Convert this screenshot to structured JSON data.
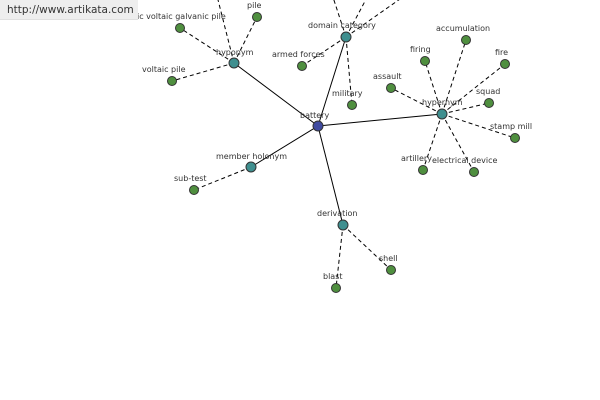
{
  "watermark": "http://www.artikata.com",
  "colors": {
    "center": "#3f4aa0",
    "relation": "#3f8f8f",
    "leaf": "#4f8f3f",
    "edge": "#000000"
  },
  "nodes": [
    {
      "id": "battery",
      "label": "battery",
      "kind": "center"
    },
    {
      "id": "hyponym",
      "label": "hyponym",
      "kind": "relation"
    },
    {
      "id": "domain-category",
      "label": "domain category",
      "kind": "relation"
    },
    {
      "id": "hypernym",
      "label": "hypernym",
      "kind": "relation"
    },
    {
      "id": "member-holonym",
      "label": "member holonym",
      "kind": "relation"
    },
    {
      "id": "derivation",
      "label": "derivation",
      "kind": "relation"
    },
    {
      "id": "voltaic-galvanic-pile",
      "label": "ic voltaic galvanic pile",
      "kind": "leaf"
    },
    {
      "id": "pile",
      "label": "pile",
      "kind": "leaf"
    },
    {
      "id": "voltaic-pile",
      "label": "voltaic pile",
      "kind": "leaf"
    },
    {
      "id": "armed-forces",
      "label": "armed forces",
      "kind": "leaf"
    },
    {
      "id": "military",
      "label": "military",
      "kind": "leaf"
    },
    {
      "id": "accumulation",
      "label": "accumulation",
      "kind": "leaf"
    },
    {
      "id": "firing",
      "label": "firing",
      "kind": "leaf"
    },
    {
      "id": "fire",
      "label": "fire",
      "kind": "leaf"
    },
    {
      "id": "assault",
      "label": "assault",
      "kind": "leaf"
    },
    {
      "id": "squad",
      "label": "squad",
      "kind": "leaf"
    },
    {
      "id": "stamp-mill",
      "label": "stamp mill",
      "kind": "leaf"
    },
    {
      "id": "artillery",
      "label": "artillery",
      "kind": "leaf"
    },
    {
      "id": "electrical-device",
      "label": "electrical device",
      "kind": "leaf"
    },
    {
      "id": "sub-test",
      "label": "sub-test",
      "kind": "leaf"
    },
    {
      "id": "shell",
      "label": "shell",
      "kind": "leaf"
    },
    {
      "id": "blast",
      "label": "blast",
      "kind": "leaf"
    },
    {
      "id": "offscreen-1",
      "label": "",
      "kind": "none"
    },
    {
      "id": "offscreen-2",
      "label": "",
      "kind": "none"
    },
    {
      "id": "offscreen-3",
      "label": "",
      "kind": "none"
    },
    {
      "id": "offscreen-4",
      "label": "",
      "kind": "none"
    }
  ],
  "edges": [
    {
      "from": "battery",
      "to": "hyponym",
      "style": "solid"
    },
    {
      "from": "battery",
      "to": "domain-category",
      "style": "solid"
    },
    {
      "from": "battery",
      "to": "hypernym",
      "style": "solid"
    },
    {
      "from": "battery",
      "to": "member-holonym",
      "style": "solid"
    },
    {
      "from": "battery",
      "to": "derivation",
      "style": "solid"
    },
    {
      "from": "hyponym",
      "to": "voltaic-galvanic-pile",
      "style": "dashed"
    },
    {
      "from": "hyponym",
      "to": "pile",
      "style": "dashed"
    },
    {
      "from": "hyponym",
      "to": "voltaic-pile",
      "style": "dashed"
    },
    {
      "from": "hyponym",
      "to": "offscreen-1",
      "style": "dashed"
    },
    {
      "from": "domain-category",
      "to": "armed-forces",
      "style": "dashed"
    },
    {
      "from": "domain-category",
      "to": "military",
      "style": "dashed"
    },
    {
      "from": "domain-category",
      "to": "offscreen-2",
      "style": "dashed"
    },
    {
      "from": "domain-category",
      "to": "offscreen-3",
      "style": "dashed"
    },
    {
      "from": "domain-category",
      "to": "offscreen-4",
      "style": "dashed"
    },
    {
      "from": "hypernym",
      "to": "accumulation",
      "style": "dashed"
    },
    {
      "from": "hypernym",
      "to": "firing",
      "style": "dashed"
    },
    {
      "from": "hypernym",
      "to": "fire",
      "style": "dashed"
    },
    {
      "from": "hypernym",
      "to": "assault",
      "style": "dashed"
    },
    {
      "from": "hypernym",
      "to": "squad",
      "style": "dashed"
    },
    {
      "from": "hypernym",
      "to": "stamp-mill",
      "style": "dashed"
    },
    {
      "from": "hypernym",
      "to": "artillery",
      "style": "dashed"
    },
    {
      "from": "hypernym",
      "to": "electrical-device",
      "style": "dashed"
    },
    {
      "from": "member-holonym",
      "to": "sub-test",
      "style": "dashed"
    },
    {
      "from": "derivation",
      "to": "shell",
      "style": "dashed"
    },
    {
      "from": "derivation",
      "to": "blast",
      "style": "dashed"
    }
  ]
}
